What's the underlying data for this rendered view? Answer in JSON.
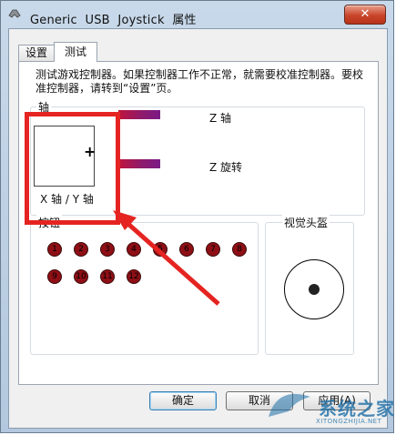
{
  "window": {
    "title": "Generic  USB  Joystick  属性",
    "close_label": "✕"
  },
  "tabs": [
    {
      "label": "设置"
    },
    {
      "label": "测试"
    }
  ],
  "description": "测试游戏控制器。如果控制器工作不正常，就需要校准控制器。要校准控制器，请转到“设置”页。",
  "axes": {
    "group_title": "轴",
    "xy_label": "X 轴 / Y 轴",
    "z_label": "Z 轴",
    "z_rotation_label": "Z 旋转",
    "crosshair": "+"
  },
  "buttons_group": {
    "title": "按钮",
    "buttons": [
      "1",
      "2",
      "3",
      "4",
      "5",
      "6",
      "7",
      "8",
      "9",
      "10",
      "11",
      "12"
    ]
  },
  "pov": {
    "title": "视觉头盔"
  },
  "dialog_buttons": {
    "ok": "确定",
    "cancel": "取消",
    "apply": "应用(A)"
  },
  "watermark": {
    "text": "系统之家",
    "sub": "XITONGZHIJIA.NET"
  },
  "colors": {
    "highlight": "#e52421",
    "button_fill": "#8e0f15",
    "bar_start": "#c0143c",
    "bar_end": "#7a1a86"
  }
}
